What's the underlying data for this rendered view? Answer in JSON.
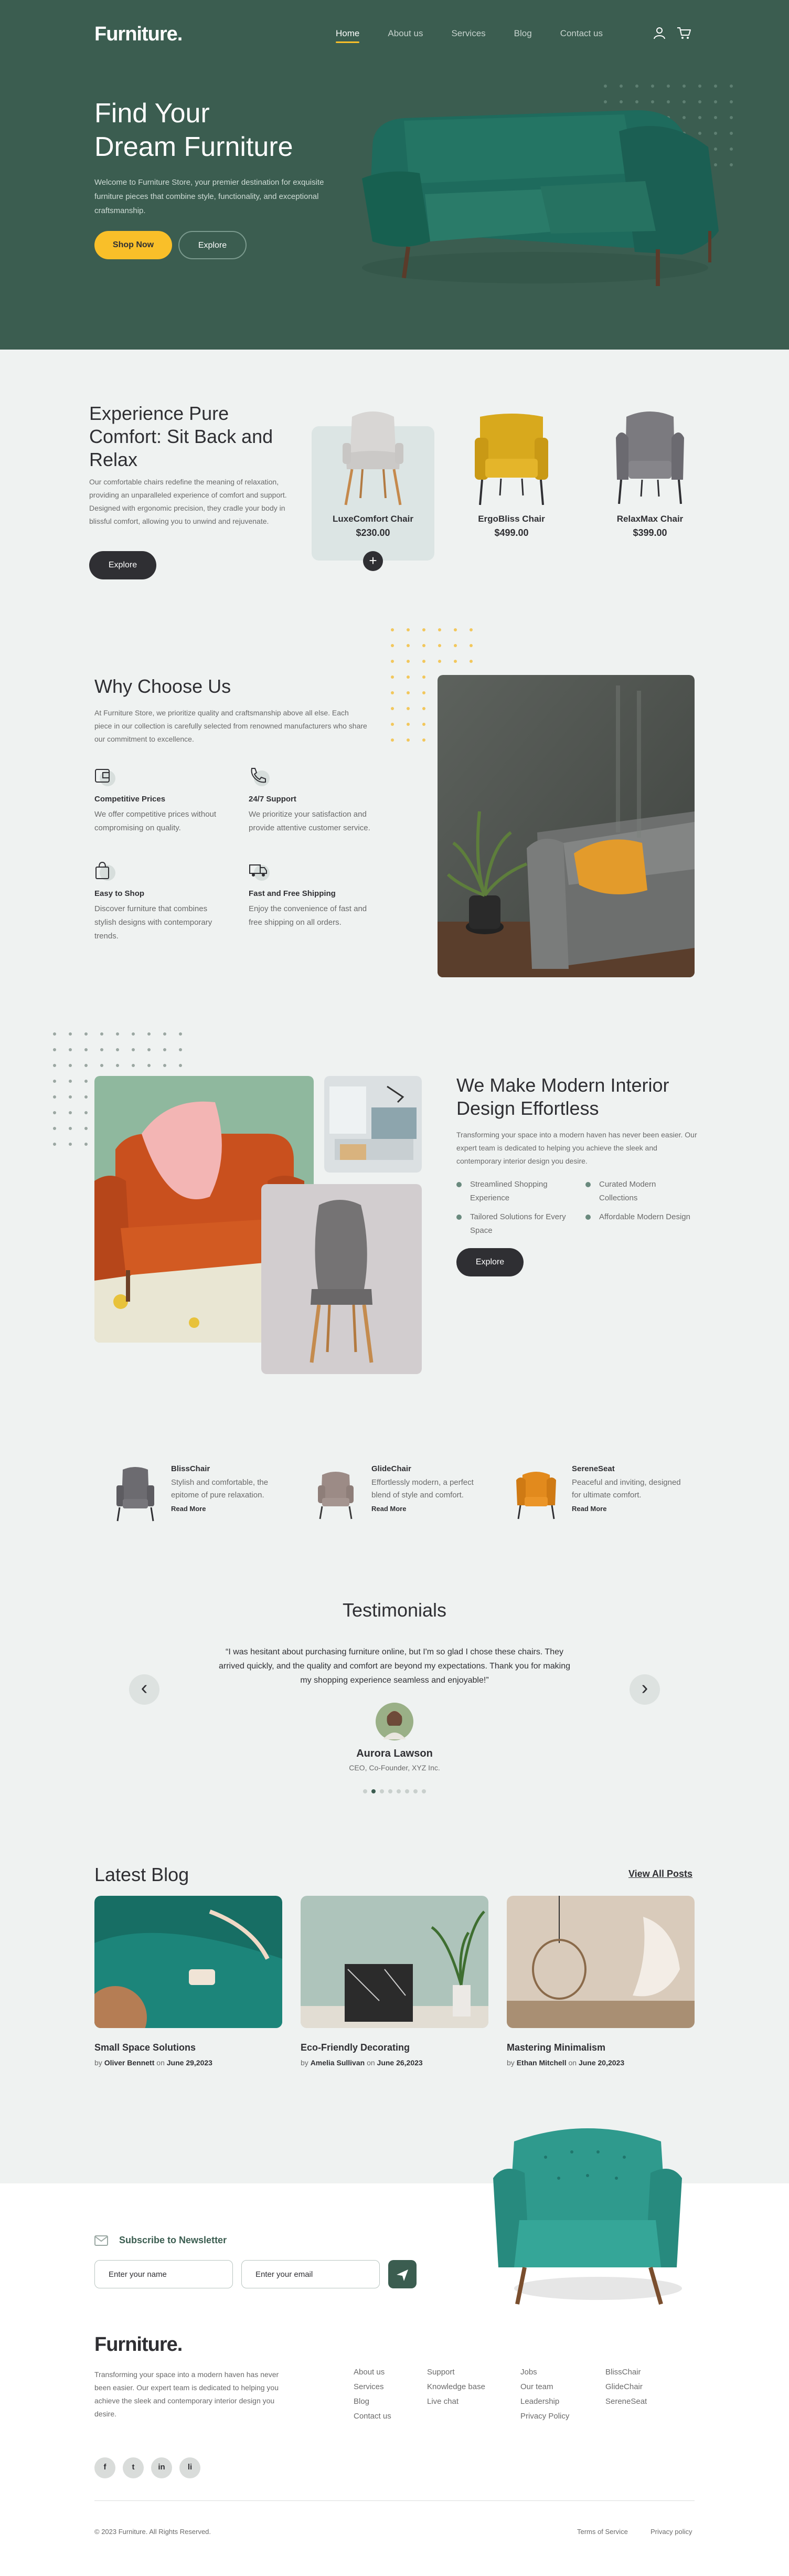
{
  "brand": {
    "logo": "Furniture",
    "logo_dot": "."
  },
  "nav": {
    "items": [
      "Home",
      "About us",
      "Services",
      "Blog",
      "Contact us"
    ]
  },
  "hero": {
    "title_line1": "Find Your",
    "title_line2": "Dream Furniture",
    "lead": "Welcome to Furniture Store, your premier destination for exquisite furniture pieces that combine style, functionality, and exceptional craftsmanship.",
    "shop_now": "Shop Now",
    "explore": "Explore"
  },
  "comfort": {
    "title": "Experience Pure Comfort: Sit Back and Relax",
    "text": "Our comfortable chairs redefine the meaning of relaxation, providing an unparalleled experience of comfort and support. Designed with ergonomic precision, they cradle your body in blissful comfort, allowing you to unwind and rejuvenate.",
    "explore": "Explore",
    "products": [
      {
        "name": "LuxeComfort Chair",
        "price": "$230.00"
      },
      {
        "name": "ErgoBliss Chair",
        "price": "$499.00"
      },
      {
        "name": "RelaxMax Chair",
        "price": "$399.00"
      }
    ],
    "plus": "+"
  },
  "why": {
    "title": "Why Choose Us",
    "text": "At Furniture Store, we prioritize quality and craftsmanship above all else. Each piece in our collection is carefully selected from renowned manufacturers who share our commitment to excellence.",
    "features": [
      {
        "title": "Competitive Prices",
        "text": "We offer competitive prices without compromising on quality."
      },
      {
        "title": "24/7 Support",
        "text": "We prioritize your satisfaction and provide attentive customer service."
      },
      {
        "title": "Easy to Shop",
        "text": "Discover furniture that combines stylish designs with contemporary trends."
      },
      {
        "title": "Fast and Free Shipping",
        "text": "Enjoy the convenience of fast and free shipping on all orders."
      }
    ]
  },
  "interior": {
    "title": "We Make Modern Interior Design Effortless",
    "text": "Transforming your space into a modern haven has never been easier. Our expert team is dedicated to helping you achieve the sleek and contemporary interior design you desire.",
    "bullets": [
      "Streamlined Shopping Experience",
      "Curated Modern Collections",
      "Tailored Solutions for Every Space",
      "Affordable Modern Design"
    ],
    "explore": "Explore"
  },
  "mini_products": [
    {
      "title": "BlissChair",
      "text": "Stylish and comfortable, the epitome of pure relaxation.",
      "read_more": "Read More"
    },
    {
      "title": "GlideChair",
      "text": "Effortlessly modern, a perfect blend of style and comfort.",
      "read_more": "Read More"
    },
    {
      "title": "SereneSeat",
      "text": "Peaceful and inviting, designed for ultimate comfort.",
      "read_more": "Read More"
    }
  ],
  "testimonials": {
    "title": "Testimonials",
    "quote": "“I was hesitant about purchasing furniture online, but I'm so glad I chose these chairs. They arrived quickly, and the quality and comfort are beyond my expectations. Thank you for making my shopping experience seamless and enjoyable!”",
    "name": "Aurora Lawson",
    "role": "CEO, Co-Founder, XYZ Inc.",
    "prev": "‹",
    "next": "›",
    "page_count": 8,
    "active_page": 2
  },
  "blog": {
    "title": "Latest Blog",
    "view_all": "View All Posts",
    "by": "by",
    "on": "on",
    "posts": [
      {
        "title": "Small Space Solutions",
        "author": "Oliver Bennett",
        "date": "June 29,2023"
      },
      {
        "title": "Eco-Friendly Decorating",
        "author": "Amelia Sullivan",
        "date": "June 26,2023"
      },
      {
        "title": "Mastering Minimalism",
        "author": "Ethan Mitchell",
        "date": "June 20,2023"
      }
    ]
  },
  "newsletter": {
    "title": "Subscribe to Newsletter",
    "name_placeholder": "Enter your name",
    "email_placeholder": "Enter your email"
  },
  "footer": {
    "about": "Transforming your space into a modern haven has never been easier. Our expert team is dedicated to helping you achieve the sleek and contemporary interior design you desire.",
    "col1": [
      "About us",
      "Services",
      "Blog",
      "Contact us"
    ],
    "col2": [
      "Support",
      "Knowledge base",
      "Live chat"
    ],
    "col3": [
      "Jobs",
      "Our team",
      "Leadership",
      "Privacy Policy"
    ],
    "col4": [
      "BlissChair",
      "GlideChair",
      "SereneSeat"
    ],
    "social": [
      "f",
      "t",
      "in",
      "li"
    ],
    "copyright": "© 2023 Furniture. All Rights Reserved.",
    "terms": "Terms of Service",
    "privacy": "Privacy policy"
  },
  "colors": {
    "primary": "#3b5d50",
    "accent": "#f9bf29",
    "dark": "#2f2f33",
    "bg": "#eff2f1"
  }
}
